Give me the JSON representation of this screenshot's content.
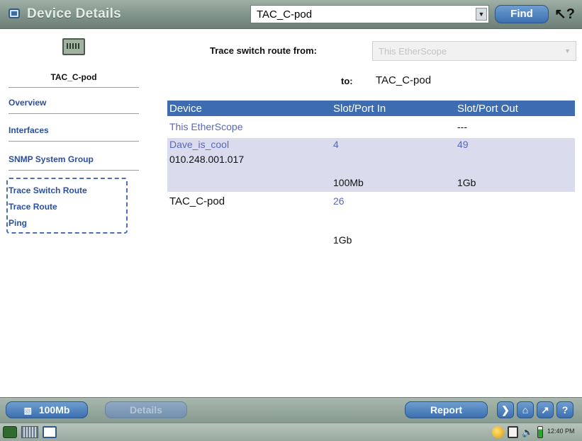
{
  "window": {
    "title": "Device Details",
    "device_select_value": "TAC_C-pod",
    "find_label": "Find"
  },
  "sidebar": {
    "device_name": "TAC_C-pod",
    "nav": [
      "Overview",
      "Interfaces",
      "SNMP System Group"
    ],
    "tools": [
      "Trace Switch Route",
      "Trace Route",
      "Ping"
    ]
  },
  "trace": {
    "from_label": "Trace switch route from:",
    "from_value": "This EtherScope",
    "to_label": "to:",
    "to_value": "TAC_C-pod"
  },
  "table": {
    "columns": [
      "Device",
      "Slot/Port In",
      "Slot/Port Out"
    ],
    "rows": {
      "etherscope": {
        "device": "This EtherScope",
        "port_out": "---"
      },
      "dave": {
        "device": "Dave_is_cool",
        "ip": "010.248.001.017",
        "port_in": "4",
        "port_out": "49",
        "speed_in": "100Mb",
        "speed_out": "1Gb"
      },
      "tac": {
        "device": "TAC_C-pod",
        "port_in": "26",
        "speed_in": "1Gb"
      }
    }
  },
  "toolbar": {
    "link_label": "100Mb",
    "details_label": "Details",
    "report_label": "Report",
    "nav_glyphs": [
      "❯",
      "⌂",
      "↗",
      "?"
    ]
  },
  "taskbar": {
    "clock": "12:40 PM"
  },
  "colors": {
    "accent_blue": "#3d6db0",
    "link_blue": "#2a4fa0",
    "row_band": "#dadcee",
    "chrome_green": "#869a8f"
  }
}
